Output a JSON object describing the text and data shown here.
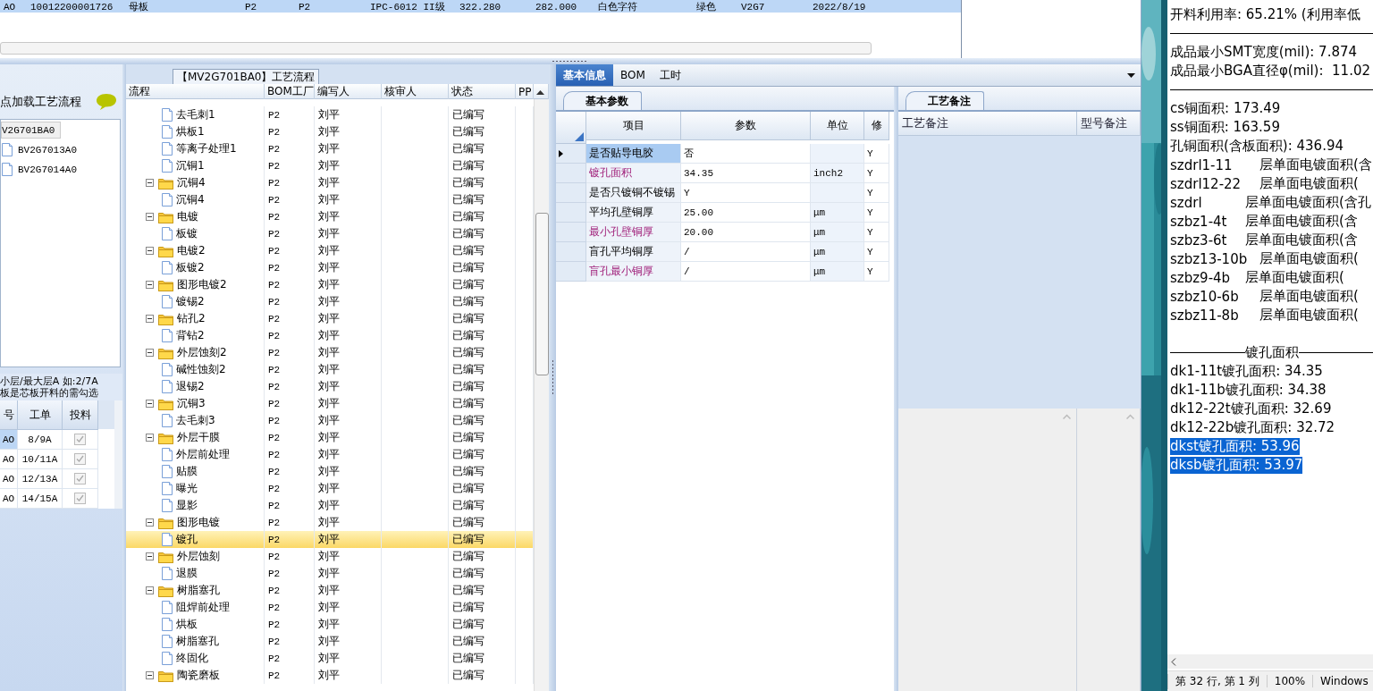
{
  "top_table": {
    "row": {
      "selected": true,
      "cells": [
        "AO",
        "10012200001726",
        "母板",
        "P2",
        "P2",
        "IPC-6012 II级",
        "322.280",
        "282.000",
        "白色字符",
        "绿色",
        "V2G7",
        "2022/8/19"
      ]
    }
  },
  "left_panel": {
    "hint": "点加载工艺流程",
    "list": [
      {
        "label": "V2G701BA0",
        "selected": true
      },
      {
        "label": "BV2G7013A0",
        "selected": false
      },
      {
        "label": "BV2G7014A0",
        "selected": false
      }
    ],
    "notes": [
      "小层/最大层A 如:2/7A",
      "板是芯板开料的需勾选"
    ],
    "table": {
      "columns": [
        "号",
        "工单",
        "投料"
      ],
      "rows": [
        {
          "cells": [
            "AO",
            "8/9A"
          ],
          "checked": true,
          "selected": true
        },
        {
          "cells": [
            "AO",
            "10/11A"
          ],
          "checked": true,
          "selected": false
        },
        {
          "cells": [
            "AO",
            "12/13A"
          ],
          "checked": true,
          "selected": false
        },
        {
          "cells": [
            "AO",
            "14/15A"
          ],
          "checked": true,
          "selected": false
        }
      ]
    }
  },
  "process_panel": {
    "title": "【MV2G701BA0】工艺流程",
    "columns": [
      "流程",
      "BOM工厂",
      "编写人",
      "核审人",
      "状态",
      "PP"
    ],
    "tree": [
      {
        "children": [
          {
            "label": "去毛刺1",
            "factory": "P2",
            "author": "刘平",
            "status": "已编写",
            "selected": false
          },
          {
            "label": "烘板1",
            "factory": "P2",
            "author": "刘平",
            "status": "已编写",
            "selected": false
          },
          {
            "label": "等离子处理1",
            "factory": "P2",
            "author": "刘平",
            "status": "已编写",
            "selected": false
          },
          {
            "label": "沉铜1",
            "factory": "P2",
            "author": "刘平",
            "status": "已编写",
            "selected": false
          }
        ]
      },
      {
        "label": "沉铜4",
        "factory": "P2",
        "author": "刘平",
        "status": "已编写",
        "selected": false,
        "expanded": true,
        "children": [
          {
            "label": "沉铜4",
            "factory": "P2",
            "author": "刘平",
            "status": "已编写",
            "selected": false
          }
        ]
      },
      {
        "label": "电镀",
        "factory": "P2",
        "author": "刘平",
        "status": "已编写",
        "selected": false,
        "expanded": true,
        "children": [
          {
            "label": "板镀",
            "factory": "P2",
            "author": "刘平",
            "status": "已编写",
            "selected": false
          }
        ]
      },
      {
        "label": "电镀2",
        "factory": "P2",
        "author": "刘平",
        "status": "已编写",
        "selected": false,
        "expanded": true,
        "children": [
          {
            "label": "板镀2",
            "factory": "P2",
            "author": "刘平",
            "status": "已编写",
            "selected": false
          }
        ]
      },
      {
        "label": "图形电镀2",
        "factory": "P2",
        "author": "刘平",
        "status": "已编写",
        "selected": false,
        "expanded": true,
        "children": [
          {
            "label": "镀锡2",
            "factory": "P2",
            "author": "刘平",
            "status": "已编写",
            "selected": false
          }
        ]
      },
      {
        "label": "钻孔2",
        "factory": "P2",
        "author": "刘平",
        "status": "已编写",
        "selected": false,
        "expanded": true,
        "children": [
          {
            "label": "背钻2",
            "factory": "P2",
            "author": "刘平",
            "status": "已编写",
            "selected": false
          }
        ]
      },
      {
        "label": "外层蚀刻2",
        "factory": "P2",
        "author": "刘平",
        "status": "已编写",
        "selected": false,
        "expanded": true,
        "children": [
          {
            "label": "碱性蚀刻2",
            "factory": "P2",
            "author": "刘平",
            "status": "已编写",
            "selected": false
          },
          {
            "label": "退锡2",
            "factory": "P2",
            "author": "刘平",
            "status": "已编写",
            "selected": false
          }
        ]
      },
      {
        "label": "沉铜3",
        "factory": "P2",
        "author": "刘平",
        "status": "已编写",
        "selected": false,
        "expanded": true,
        "children": [
          {
            "label": "去毛刺3",
            "factory": "P2",
            "author": "刘平",
            "status": "已编写",
            "selected": false
          }
        ]
      },
      {
        "label": "外层干膜",
        "factory": "P2",
        "author": "刘平",
        "status": "已编写",
        "selected": false,
        "expanded": true,
        "children": [
          {
            "label": "外层前处理",
            "factory": "P2",
            "author": "刘平",
            "status": "已编写",
            "selected": false
          },
          {
            "label": "贴膜",
            "factory": "P2",
            "author": "刘平",
            "status": "已编写",
            "selected": false
          },
          {
            "label": "曝光",
            "factory": "P2",
            "author": "刘平",
            "status": "已编写",
            "selected": false
          },
          {
            "label": "显影",
            "factory": "P2",
            "author": "刘平",
            "status": "已编写",
            "selected": false
          }
        ]
      },
      {
        "label": "图形电镀",
        "factory": "P2",
        "author": "刘平",
        "status": "已编写",
        "selected": false,
        "expanded": true,
        "children": [
          {
            "label": "镀孔",
            "factory": "P2",
            "author": "刘平",
            "status": "已编写",
            "selected": true
          }
        ]
      },
      {
        "label": "外层蚀刻",
        "factory": "P2",
        "author": "刘平",
        "status": "已编写",
        "selected": false,
        "expanded": true,
        "children": [
          {
            "label": "退膜",
            "factory": "P2",
            "author": "刘平",
            "status": "已编写",
            "selected": false
          }
        ]
      },
      {
        "label": "树脂塞孔",
        "factory": "P2",
        "author": "刘平",
        "status": "已编写",
        "selected": false,
        "expanded": true,
        "children": [
          {
            "label": "阻焊前处理",
            "factory": "P2",
            "author": "刘平",
            "status": "已编写",
            "selected": false
          },
          {
            "label": "烘板",
            "factory": "P2",
            "author": "刘平",
            "status": "已编写",
            "selected": false
          },
          {
            "label": "树脂塞孔",
            "factory": "P2",
            "author": "刘平",
            "status": "已编写",
            "selected": false
          },
          {
            "label": "终固化",
            "factory": "P2",
            "author": "刘平",
            "status": "已编写",
            "selected": false
          }
        ]
      },
      {
        "label": "陶瓷磨板",
        "factory": "P2",
        "author": "刘平",
        "status": "已编写",
        "selected": false,
        "expanded": true
      }
    ]
  },
  "detail_panel": {
    "tabs": [
      {
        "label": "基本信息",
        "selected": true
      },
      {
        "label": "BOM",
        "selected": false
      },
      {
        "label": "工时",
        "selected": false
      }
    ],
    "params": {
      "tab": "基本参数",
      "columns": [
        "项目",
        "参数",
        "单位",
        "修"
      ],
      "rows": [
        {
          "item": "是否贴导电胶",
          "value": "否",
          "flag": "Y",
          "highlighted": false,
          "selected": true
        },
        {
          "item": "镀孔面积",
          "value": "34.35",
          "unit": "inch2",
          "flag": "Y",
          "highlighted": true,
          "selected": false
        },
        {
          "item": "是否只镀铜不镀锡",
          "value": "Y",
          "flag": "Y",
          "highlighted": false,
          "selected": false
        },
        {
          "item": "平均孔壁铜厚",
          "value": "25.00",
          "unit": "μm",
          "flag": "Y",
          "highlighted": false,
          "selected": false
        },
        {
          "item": "最小孔壁铜厚",
          "value": "20.00",
          "unit": "μm",
          "flag": "Y",
          "highlighted": true,
          "selected": false
        },
        {
          "item": "盲孔平均铜厚",
          "value": "/",
          "unit": "μm",
          "flag": "Y",
          "highlighted": false,
          "selected": false
        },
        {
          "item": "盲孔最小铜厚",
          "value": "/",
          "unit": "μm",
          "flag": "Y",
          "highlighted": true,
          "selected": false
        }
      ]
    },
    "notes": {
      "tab": "工艺备注",
      "columns": [
        "工艺备注",
        "型号备注"
      ]
    }
  },
  "notepad": {
    "lines": [
      {
        "kind": "text",
        "text": "开料利用率: 65.21% (利用率低",
        "selected": false
      },
      {
        "kind": "rule"
      },
      {
        "kind": "text",
        "text": "成品最小SMT宽度(mil): 7.874",
        "selected": false
      },
      {
        "kind": "text",
        "text": "成品最小BGA直径φ(mil):  11.02",
        "selected": false
      },
      {
        "kind": "rule"
      },
      {
        "kind": "text",
        "text": "cs铜面积: 173.49",
        "selected": false
      },
      {
        "kind": "text",
        "text": "ss铜面积: 163.59",
        "selected": false
      },
      {
        "kind": "text",
        "text": "孔铜面积(含板面积): 436.94",
        "selected": false
      },
      {
        "kind": "pair",
        "code": "szdrl1-11",
        "text": "层单面电镀面积(含",
        "selected": false
      },
      {
        "kind": "pair",
        "code": "szdrl12-22",
        "text": "层单面电镀面积(",
        "selected": false
      },
      {
        "kind": "pair",
        "code": "szdrl",
        "text": "层单面电镀面积(含孔",
        "selected": false
      },
      {
        "kind": "pair",
        "code": "szbz1-4t",
        "text": "层单面电镀面积(含",
        "selected": false
      },
      {
        "kind": "pair",
        "code": "szbz3-6t",
        "text": "层单面电镀面积(含",
        "selected": false
      },
      {
        "kind": "pair",
        "code": "szbz13-10b",
        "text": "层单面电镀面积(",
        "selected": false
      },
      {
        "kind": "pair",
        "code": "szbz9-4b",
        "text": "层单面电镀面积(",
        "selected": false
      },
      {
        "kind": "pair",
        "code": "szbz10-6b",
        "text": "层单面电镀面积(",
        "selected": false
      },
      {
        "kind": "pair",
        "code": "szbz11-8b",
        "text": "层单面电镀面积(",
        "selected": false
      },
      {
        "kind": "blank"
      },
      {
        "kind": "heading",
        "text": "镀孔面积"
      },
      {
        "kind": "text",
        "text": "dk1-11t镀孔面积: 34.35",
        "selected": false
      },
      {
        "kind": "text",
        "text": "dk1-11b镀孔面积: 34.38",
        "selected": false
      },
      {
        "kind": "text",
        "text": "dk12-22t镀孔面积: 32.69",
        "selected": false
      },
      {
        "kind": "text",
        "text": "dk12-22b镀孔面积: 32.72",
        "selected": false
      },
      {
        "kind": "text",
        "text": "dkst镀孔面积: 53.96",
        "selected": true
      },
      {
        "kind": "text",
        "text": "dksb镀孔面积: 53.97",
        "selected": true
      }
    ],
    "status_bar": [
      "第 32 行, 第 1 列",
      "100%",
      "Windows"
    ]
  }
}
